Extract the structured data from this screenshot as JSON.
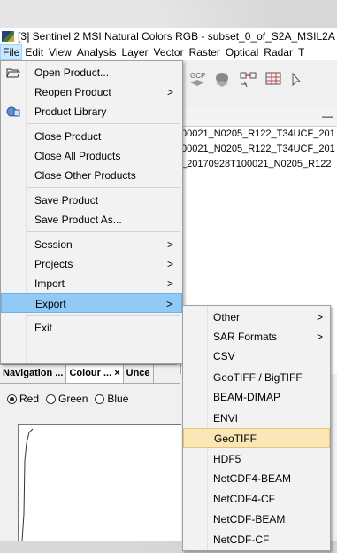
{
  "window": {
    "title": "[3] Sentinel 2 MSI Natural Colors RGB - subset_0_of_S2A_MSIL2A"
  },
  "menubar": [
    "File",
    "Edit",
    "View",
    "Analysis",
    "Layer",
    "Vector",
    "Raster",
    "Optical",
    "Radar",
    "T"
  ],
  "toolbar": {
    "gcp_label": "GCP"
  },
  "file_menu": {
    "items": [
      {
        "label": "Open Product...",
        "icon": "folder-open-icon"
      },
      {
        "label": "Reopen Product",
        "arrow": ">"
      },
      {
        "label": "Product Library",
        "icon": "product-library-icon"
      },
      {
        "label": "Close Product"
      },
      {
        "label": "Close All Products"
      },
      {
        "label": "Close Other Products"
      },
      {
        "label": "Save Product"
      },
      {
        "label": "Save Product As..."
      },
      {
        "label": "Session",
        "arrow": ">"
      },
      {
        "label": "Projects",
        "arrow": ">"
      },
      {
        "label": "Import",
        "arrow": ">"
      },
      {
        "label": "Export",
        "arrow": ">",
        "highlighted": true
      },
      {
        "label": "Exit"
      }
    ]
  },
  "export_submenu": {
    "items": [
      {
        "label": "Other",
        "arrow": ">"
      },
      {
        "label": "SAR Formats",
        "arrow": ">"
      },
      {
        "label": "CSV"
      },
      {
        "label": "GeoTIFF / BigTIFF"
      },
      {
        "label": "BEAM-DIMAP"
      },
      {
        "label": "ENVI"
      },
      {
        "label": "GeoTIFF",
        "highlighted": true
      },
      {
        "label": "HDF5"
      },
      {
        "label": "NetCDF4-BEAM"
      },
      {
        "label": "NetCDF4-CF"
      },
      {
        "label": "NetCDF-BEAM"
      },
      {
        "label": "NetCDF-CF"
      }
    ]
  },
  "product_panel": {
    "dash": "—",
    "rows": [
      "00021_N0205_R122_T34UCF_201",
      "00021_N0205_R122_T34UCF_201",
      "_20170928T100021_N0205_R122"
    ]
  },
  "scroll_left": "<",
  "bottom_tabs": [
    "Navigation ...",
    "Colour ...  ×",
    "Unce"
  ],
  "colour_panel": {
    "radios": [
      "Red",
      "Green",
      "Blue"
    ],
    "selected": "Red"
  }
}
